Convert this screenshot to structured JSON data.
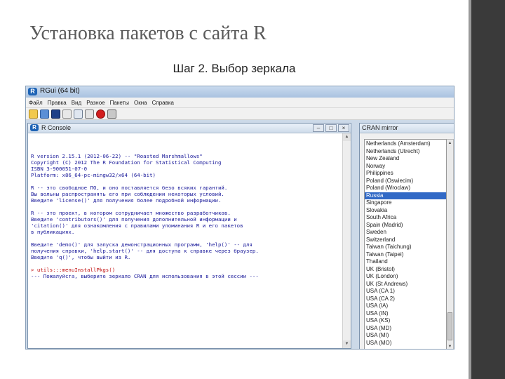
{
  "slide": {
    "title": "Установка пакетов с сайта R",
    "subtitle": "Шаг 2. Выбор зеркала"
  },
  "rgui": {
    "title": "RGui (64 bit)",
    "logo": "R",
    "menu": [
      "Файл",
      "Правка",
      "Вид",
      "Разное",
      "Пакеты",
      "Окна",
      "Справка"
    ],
    "toolbar_icons": [
      "open-script-icon",
      "load-workspace-icon",
      "save-icon",
      "copy-icon",
      "paste-icon",
      "copy-paste-icon",
      "stop-icon",
      "print-icon"
    ],
    "console": {
      "title": "R Console",
      "lines": [
        "R version 2.15.1 (2012-06-22) -- \"Roasted Marshmallows\"",
        "Copyright (C) 2012 The R Foundation for Statistical Computing",
        "ISBN 3-900051-07-0",
        "Platform: x86_64-pc-mingw32/x64 (64-bit)",
        "",
        "R -- это свободное ПО, и оно поставляется безо всяких гарантий.",
        "Вы вольны распространять его при соблюдении некоторых условий.",
        "Введите 'license()' для получения более подробной информации.",
        "",
        "R -- это проект, в котором сотрудничает множество разработчиков.",
        "Введите 'contributors()' для получения дополнительной информации и",
        "'citation()' для ознакомления с правилами упоминания R и его пакетов",
        "в публикациях.",
        "",
        "Введите 'demo()' для запуска демонстрационных программ, 'help()' -- для",
        "получения справки, 'help.start()' -- для доступа к справке через браузер.",
        "Введите 'q()', чтобы выйти из R.",
        "",
        "> utils:::menuInstallPkgs()",
        "--- Пожалуйста, выберите зеркало CRAN для использования в этой сессии ---"
      ]
    }
  },
  "cran_dialog": {
    "title": "CRAN mirror",
    "selected": "Russia",
    "mirrors": [
      "Netherlands (Amsterdam)",
      "Netherlands (Utrecht)",
      "New Zealand",
      "Norway",
      "Philippines",
      "Poland (Oswiecim)",
      "Poland (Wroclaw)",
      "Russia",
      "Singapore",
      "Slovakia",
      "South Africa",
      "Spain (Madrid)",
      "Sweden",
      "Switzerland",
      "Taiwan (Taichung)",
      "Taiwan (Taipei)",
      "Thailand",
      "UK (Bristol)",
      "UK (London)",
      "UK (St Andrews)",
      "USA (CA 1)",
      "USA (CA 2)",
      "USA (IA)",
      "USA (IN)",
      "USA (KS)",
      "USA (MD)",
      "USA (MI)",
      "USA (MO)"
    ]
  }
}
